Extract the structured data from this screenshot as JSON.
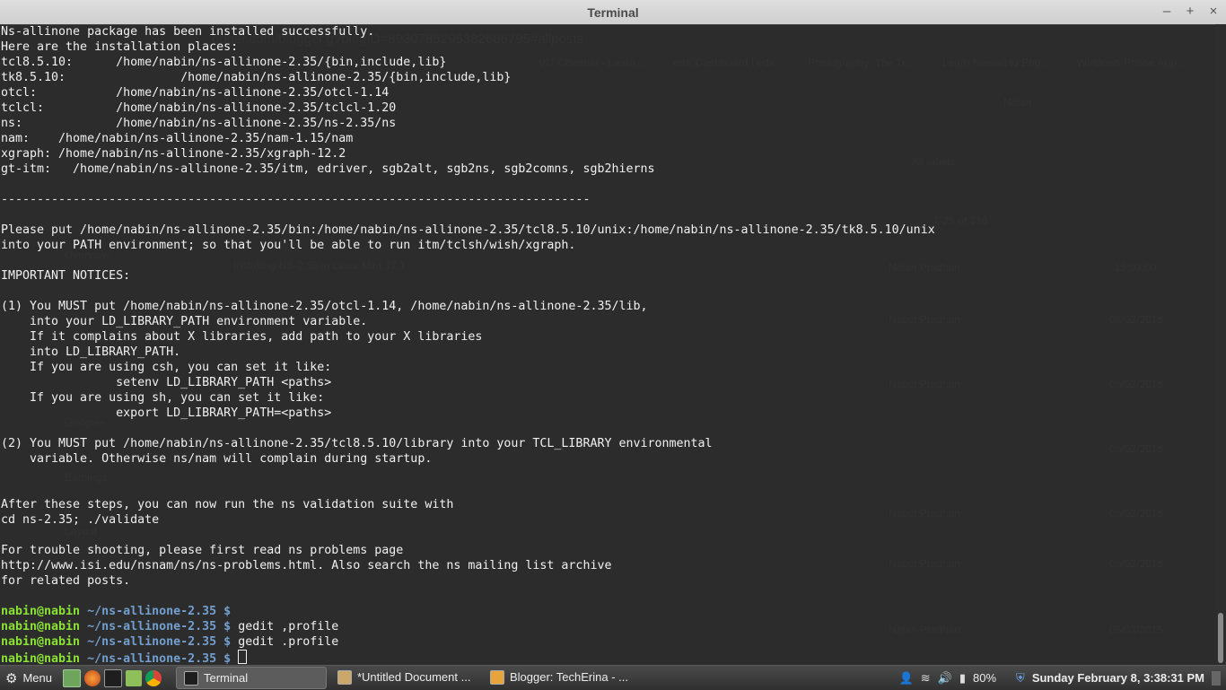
{
  "window": {
    "title": "Terminal",
    "controls": [
      "–",
      "+",
      "×"
    ]
  },
  "terminal_lines": [
    "Ns-allinone package has been installed successfully.",
    "Here are the installation places:",
    "tcl8.5.10:      /home/nabin/ns-allinone-2.35/{bin,include,lib}",
    "tk8.5.10:                /home/nabin/ns-allinone-2.35/{bin,include,lib}",
    "otcl:           /home/nabin/ns-allinone-2.35/otcl-1.14",
    "tclcl:          /home/nabin/ns-allinone-2.35/tclcl-1.20",
    "ns:             /home/nabin/ns-allinone-2.35/ns-2.35/ns",
    "nam:    /home/nabin/ns-allinone-2.35/nam-1.15/nam",
    "xgraph: /home/nabin/ns-allinone-2.35/xgraph-12.2",
    "gt-itm:   /home/nabin/ns-allinone-2.35/itm, edriver, sgb2alt, sgb2ns, sgb2comns, sgb2hierns",
    "",
    "----------------------------------------------------------------------------------",
    "",
    "Please put /home/nabin/ns-allinone-2.35/bin:/home/nabin/ns-allinone-2.35/tcl8.5.10/unix:/home/nabin/ns-allinone-2.35/tk8.5.10/unix",
    "into your PATH environment; so that you'll be able to run itm/tclsh/wish/xgraph.",
    "",
    "IMPORTANT NOTICES:",
    "",
    "(1) You MUST put /home/nabin/ns-allinone-2.35/otcl-1.14, /home/nabin/ns-allinone-2.35/lib,",
    "    into your LD_LIBRARY_PATH environment variable.",
    "    If it complains about X libraries, add path to your X libraries",
    "    into LD_LIBRARY_PATH.",
    "    If you are using csh, you can set it like:",
    "                setenv LD_LIBRARY_PATH <paths>",
    "    If you are using sh, you can set it like:",
    "                export LD_LIBRARY_PATH=<paths>",
    "",
    "(2) You MUST put /home/nabin/ns-allinone-2.35/tcl8.5.10/library into your TCL_LIBRARY environmental",
    "    variable. Otherwise ns/nam will complain during startup.",
    "",
    "",
    "After these steps, you can now run the ns validation suite with",
    "cd ns-2.35; ./validate",
    "",
    "For trouble shooting, please first read ns problems page",
    "http://www.isi.edu/nsnam/ns/ns-problems.html. Also search the ns mailing list archive",
    "for related posts.",
    ""
  ],
  "prompts": [
    {
      "user": "nabin@nabin",
      "path": "~/ns-allinone-2.35 $",
      "command": ""
    },
    {
      "user": "nabin@nabin",
      "path": "~/ns-allinone-2.35 $",
      "command": " gedit ,profile"
    },
    {
      "user": "nabin@nabin",
      "path": "~/ns-allinone-2.35 $",
      "command": " gedit .profile"
    },
    {
      "user": "nabin@nabin",
      "path": "~/ns-allinone-2.35 $",
      "command": " "
    }
  ],
  "background_window": {
    "url_fragment": "ogger.com/blogger.g?blogID=8930785295382686795#allposts",
    "bookmarks": [
      "VIT Chennai - Learn...",
      "edX Dashboard | edX",
      "Photography: The Tr...",
      "Learn Newari to Eng...",
      "Windows Phone App..."
    ],
    "sidebar": [
      "Overview",
      "Google+",
      "Earnings",
      "Layout"
    ],
    "user": "Nabin",
    "filter": "All labels",
    "paging": "1-25 of 216",
    "post_title": "Installing NS-2.35 in Linux Mint 17.1",
    "author": "Nabin Pradhan",
    "dates": [
      "15:03:00",
      "08/02/2015",
      "05/02/2015",
      "05/02/2015",
      "05/02/2015",
      "05/02/2015",
      "05/02/2015"
    ]
  },
  "taskbar": {
    "menu_label": "Menu",
    "tasks": [
      {
        "label": "Terminal",
        "active": true,
        "color": "#1e1e1e"
      },
      {
        "label": "*Untitled Document ...",
        "active": false,
        "color": "#c9a86a"
      },
      {
        "label": "Blogger: TechErina - ...",
        "active": false,
        "color": "#e8a33a"
      }
    ],
    "battery": "80%",
    "clock": "Sunday February  8,  3:38:31 PM"
  },
  "colors": {
    "prompt_user": "#8ae234",
    "prompt_path": "#729fcf",
    "terminal_text": "#f0f0f0"
  }
}
